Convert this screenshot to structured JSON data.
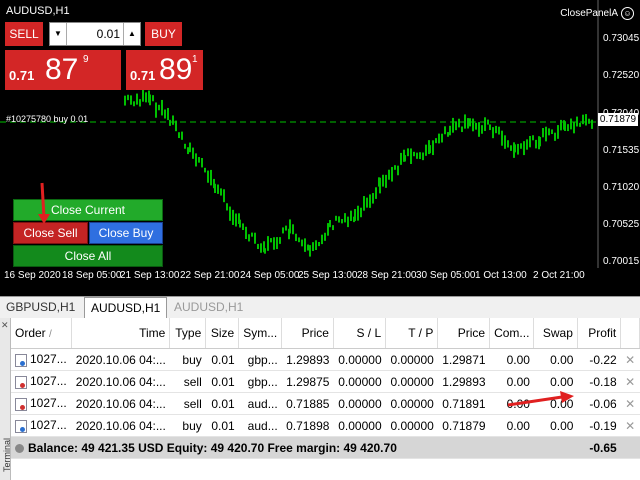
{
  "chart": {
    "title": "AUDUSD,H1",
    "panel_label": "ClosePanelA",
    "order_label": "#10275780 buy 0.01",
    "current_price": "0.71879",
    "price_axis": [
      "0.73045",
      "0.72520",
      "0.72040",
      "0.71535",
      "0.71020",
      "0.70525",
      "0.70015"
    ],
    "time_axis": [
      "16 Sep 2020",
      "18 Sep 05:00",
      "21 Sep 13:00",
      "22 Sep 21:00",
      "24 Sep 05:00",
      "25 Sep 13:00",
      "28 Sep 21:00",
      "30 Sep 05:00",
      "1 Oct 13:00",
      "2 Oct 21:00"
    ]
  },
  "trade_panel": {
    "sell_label": "SELL",
    "buy_label": "BUY",
    "lot": "0.01",
    "sell_price": {
      "small": "0.71",
      "big": "87",
      "sup": "9"
    },
    "buy_price": {
      "small": "0.71",
      "big": "89",
      "sup": "1"
    }
  },
  "close_panel": {
    "current": "Close Current",
    "sell": "Close Sell",
    "buy": "Close Buy",
    "all": "Close All"
  },
  "tabs": [
    {
      "label": "GBPUSD,H1"
    },
    {
      "label": "AUDUSD,H1"
    },
    {
      "label": "AUDUSD,H1"
    }
  ],
  "terminal": {
    "side_label": "Terminal",
    "columns": [
      "Order",
      "Time",
      "Type",
      "Size",
      "Sym...",
      "Price",
      "S / L",
      "T / P",
      "Price",
      "Com...",
      "Swap",
      "Profit"
    ],
    "sort_indicator": "/",
    "rows": [
      {
        "order": "1027...",
        "time": "2020.10.06 04:...",
        "type": "buy",
        "size": "0.01",
        "symbol": "gbp...",
        "price": "1.29893",
        "sl": "0.00000",
        "tp": "0.00000",
        "cur_price": "1.29871",
        "commission": "0.00",
        "swap": "0.00",
        "profit": "-0.22"
      },
      {
        "order": "1027...",
        "time": "2020.10.06 04:...",
        "type": "sell",
        "size": "0.01",
        "symbol": "gbp...",
        "price": "1.29875",
        "sl": "0.00000",
        "tp": "0.00000",
        "cur_price": "1.29893",
        "commission": "0.00",
        "swap": "0.00",
        "profit": "-0.18"
      },
      {
        "order": "1027...",
        "time": "2020.10.06 04:...",
        "type": "sell",
        "size": "0.01",
        "symbol": "aud...",
        "price": "0.71885",
        "sl": "0.00000",
        "tp": "0.00000",
        "cur_price": "0.71891",
        "commission": "0.00",
        "swap": "0.00",
        "profit": "-0.06"
      },
      {
        "order": "1027...",
        "time": "2020.10.06 04:...",
        "type": "buy",
        "size": "0.01",
        "symbol": "aud...",
        "price": "0.71898",
        "sl": "0.00000",
        "tp": "0.00000",
        "cur_price": "0.71879",
        "commission": "0.00",
        "swap": "0.00",
        "profit": "-0.19"
      }
    ],
    "balance": "Balance: 49 421.35 USD  Equity: 49 420.70  Free margin: 49 420.70",
    "total_profit": "-0.65"
  },
  "colors": {
    "sell": "#d32626",
    "buy_close": "#2f6fe0",
    "close_green": "#22aa2a",
    "candles": "#00c000",
    "annotation_arrow": "#e02020"
  },
  "icons": {
    "smile": "smiley-icon",
    "close": "close-x-icon",
    "order": "order-ticket-icon"
  }
}
